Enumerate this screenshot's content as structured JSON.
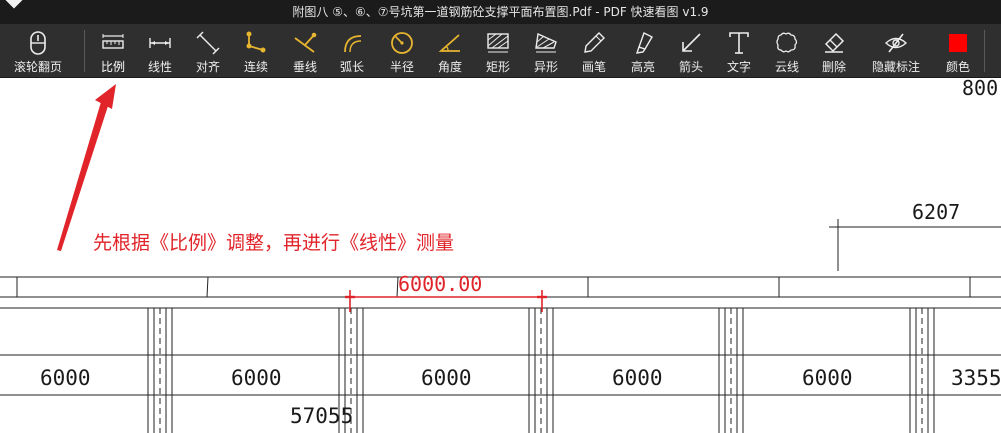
{
  "window": {
    "title": "附图八 ⑤、⑥、⑦号坑第一道钢筋砼支撑平面布置图.Pdf - PDF 快速看图 v1.9"
  },
  "toolbar": {
    "tools": [
      {
        "label": "滚轮翻页",
        "icon": "mouse-scroll-icon"
      },
      {
        "label": "比例",
        "icon": "scale-ruler-icon"
      },
      {
        "label": "线性",
        "icon": "linear-measure-icon"
      },
      {
        "label": "对齐",
        "icon": "aligned-measure-icon"
      },
      {
        "label": "连续",
        "icon": "continuous-measure-icon"
      },
      {
        "label": "垂线",
        "icon": "perpendicular-icon"
      },
      {
        "label": "弧长",
        "icon": "arc-length-icon"
      },
      {
        "label": "半径",
        "icon": "radius-icon"
      },
      {
        "label": "角度",
        "icon": "angle-icon"
      },
      {
        "label": "矩形",
        "icon": "rectangle-area-icon"
      },
      {
        "label": "异形",
        "icon": "polygon-area-icon"
      },
      {
        "label": "画笔",
        "icon": "pen-icon"
      },
      {
        "label": "高亮",
        "icon": "highlighter-icon"
      },
      {
        "label": "箭头",
        "icon": "arrow-icon"
      },
      {
        "label": "文字",
        "icon": "text-icon"
      },
      {
        "label": "云线",
        "icon": "cloud-line-icon"
      },
      {
        "label": "删除",
        "icon": "eraser-icon"
      },
      {
        "label": "隐藏标注",
        "icon": "hide-annotations-icon"
      },
      {
        "label": "颜色",
        "icon": "color-swatch-icon"
      }
    ],
    "accent_color": "#ff0000"
  },
  "drawing": {
    "top_partial_label": "800",
    "top_right_dim": "6207",
    "measurement": "6000.00",
    "annotation": "先根据《比例》调整，再进行《线性》测量",
    "bottom_dims": [
      "6000",
      "6000",
      "6000",
      "6000",
      "6000",
      "3355"
    ],
    "partial_dim": "57055",
    "annotation_color": "#e0242a"
  }
}
